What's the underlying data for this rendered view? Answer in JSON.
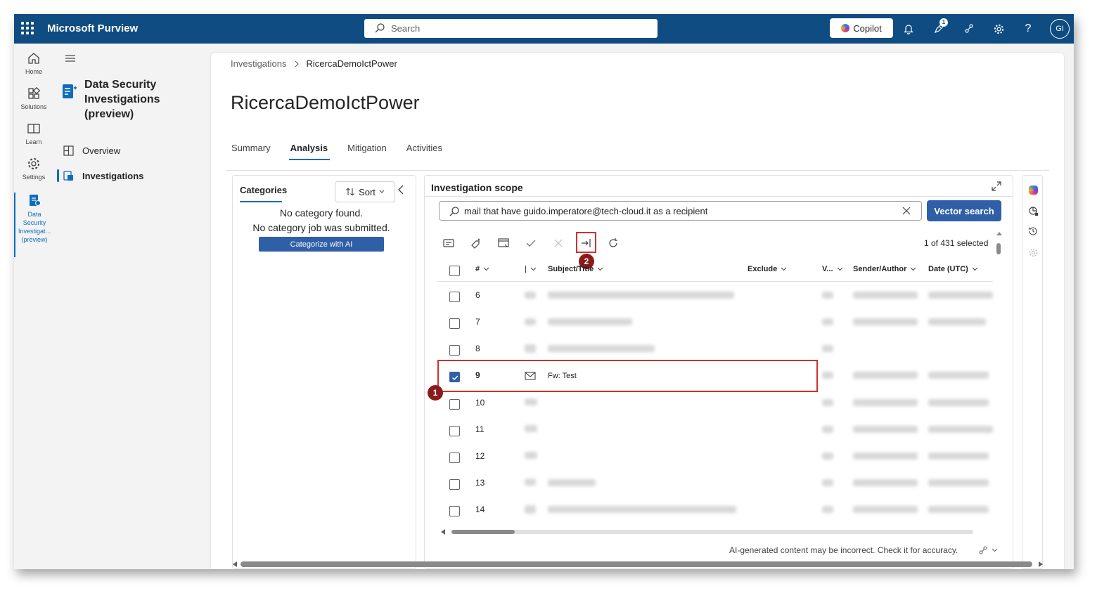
{
  "topbar": {
    "brand": "Microsoft Purview",
    "search_placeholder": "Search",
    "copilot_label": "Copilot",
    "notification_badge": "1",
    "avatar_initials": "GI"
  },
  "rail": {
    "items": [
      {
        "label": "Home",
        "icon": "home-icon"
      },
      {
        "label": "Solutions",
        "icon": "solutions-icon"
      },
      {
        "label": "Learn",
        "icon": "book-icon"
      },
      {
        "label": "Settings",
        "icon": "gear-icon"
      },
      {
        "label": "Data Security Investigat... (preview)",
        "icon": "data-security-icon"
      }
    ]
  },
  "nav": {
    "title": "Data Security Investigations (preview)",
    "items": [
      {
        "label": "Overview",
        "selected": false
      },
      {
        "label": "Investigations",
        "selected": true
      }
    ]
  },
  "breadcrumb": {
    "root": "Investigations",
    "current": "RicercaDemoIctPower"
  },
  "page_title": "RicercaDemoIctPower",
  "tabs": [
    {
      "label": "Summary",
      "selected": false
    },
    {
      "label": "Analysis",
      "selected": true
    },
    {
      "label": "Mitigation",
      "selected": false
    },
    {
      "label": "Activities",
      "selected": false
    }
  ],
  "categories": {
    "title": "Categories",
    "sort_label": "Sort",
    "empty_line1": "No category found.",
    "empty_line2": "No category job was submitted.",
    "button_label": "Categorize with AI"
  },
  "scope": {
    "title": "Investigation scope",
    "query_value": "mail that have guido.imperatore@tech-cloud.it as a recipient",
    "vector_search_label": "Vector search",
    "selected_count": "1 of 431 selected",
    "columns": [
      "#",
      "|",
      "Subject/Title",
      "Exclude",
      "V...",
      "Sender/Author",
      "Date (UTC)"
    ],
    "rows": [
      {
        "num": "6",
        "checked": false,
        "subject": ""
      },
      {
        "num": "7",
        "checked": false,
        "subject": ""
      },
      {
        "num": "8",
        "checked": false,
        "subject": ""
      },
      {
        "num": "9",
        "checked": true,
        "subject": "Fw: Test"
      },
      {
        "num": "10",
        "checked": false,
        "subject": ""
      },
      {
        "num": "11",
        "checked": false,
        "subject": ""
      },
      {
        "num": "12",
        "checked": false,
        "subject": ""
      },
      {
        "num": "13",
        "checked": false,
        "subject": ""
      },
      {
        "num": "14",
        "checked": false,
        "subject": ""
      }
    ],
    "callout_1": "1",
    "callout_2": "2",
    "disclaimer": "AI-generated content may be incorrect. Check it for accuracy."
  },
  "colors": {
    "topbar": "#0f4c81",
    "accent": "#0f6cbd",
    "button": "#2f5fa7",
    "highlight": "#d32f2f",
    "callout": "#8b1a1a"
  }
}
